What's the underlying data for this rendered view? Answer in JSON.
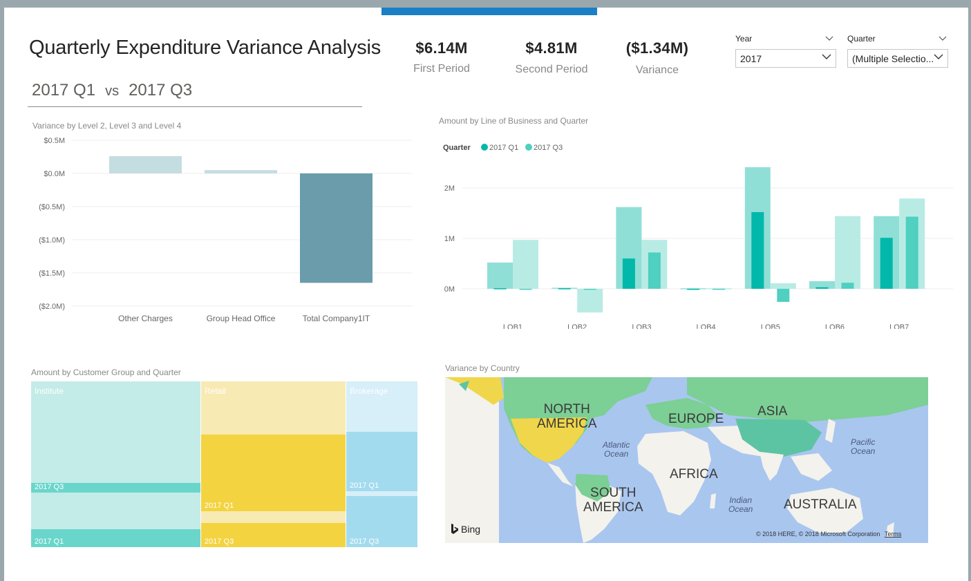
{
  "header": {
    "title": "Quarterly Expenditure Variance Analysis",
    "period_a": "2017 Q1",
    "vs": "vs",
    "period_b": "2017 Q3"
  },
  "kpis": [
    {
      "value": "$6.14M",
      "label": "First Period"
    },
    {
      "value": "$4.81M",
      "label": "Second Period"
    },
    {
      "value": "($1.34M)",
      "label": "Variance"
    }
  ],
  "slicers": {
    "year": {
      "label": "Year",
      "value": "2017"
    },
    "quarter": {
      "label": "Quarter",
      "value": "(Multiple Selectio..."
    }
  },
  "variance_chart": {
    "title": "Variance by Level 2, Level 3 and Level 4",
    "chart_data": {
      "type": "bar",
      "categories": [
        "Other Charges",
        "Group Head Office",
        "Total Company1IT"
      ],
      "values": [
        0.26,
        0.05,
        -1.65
      ],
      "ylim": [
        -2.0,
        0.5
      ],
      "yticks": [
        0.5,
        0.0,
        -0.5,
        -1.0,
        -1.5,
        -2.0
      ],
      "ytick_labels": [
        "$0.5M",
        "$0.0M",
        "($0.5M)",
        "($1.0M)",
        "($1.5M)",
        "($2.0M)"
      ],
      "colors": [
        "#c4dde1",
        "#c4dde1",
        "#6a9cab"
      ],
      "grid": true
    }
  },
  "lob_chart": {
    "title": "Amount by Line of Business and Quarter",
    "legend_title": "Quarter",
    "chart_data": {
      "type": "bar",
      "categories": [
        "LOB1",
        "LOB2",
        "LOB3",
        "LOB4",
        "LOB5",
        "LOB6",
        "LOB7"
      ],
      "series": [
        {
          "name": "2017 Q1",
          "values": [
            0.52,
            0.02,
            1.62,
            0.01,
            2.41,
            0.15,
            1.44
          ],
          "inner": [
            0.01,
            0.01,
            0.6,
            0.0,
            1.52,
            0.03,
            1.01
          ],
          "color": "#01b8aa",
          "light": "#8fdfd7"
        },
        {
          "name": "2017 Q3",
          "values": [
            0.97,
            -0.47,
            0.97,
            0.01,
            0.11,
            1.44,
            1.79
          ],
          "inner": [
            0.0,
            -0.01,
            0.72,
            0.0,
            -0.26,
            0.12,
            1.43
          ],
          "color": "#4fd0c1",
          "light": "#b9ebe5"
        }
      ],
      "ylim": [
        -0.6,
        2.5
      ],
      "yticks": [
        0,
        1,
        2
      ],
      "ytick_labels": [
        "0M",
        "1M",
        "2M"
      ],
      "legend": "top-left",
      "grid": true
    }
  },
  "treemap": {
    "title": "Amount by Customer Group and Quarter",
    "chart_data": {
      "type": "treemap",
      "groups": [
        {
          "name": "Institute",
          "color": "#6ad6cb",
          "light": "#c3ece8",
          "share": 0.44,
          "leaves": [
            {
              "label": "2017 Q3",
              "share": 0.66
            },
            {
              "label": "2017 Q1",
              "share": 0.34
            }
          ]
        },
        {
          "name": "Retail",
          "color": "#f4d340",
          "light": "#f8eab3",
          "share": 0.375,
          "leaves": [
            {
              "label": "2017 Q1",
              "share": 0.7
            },
            {
              "label": "2017 Q3",
              "share": 0.3
            }
          ]
        },
        {
          "name": "Brokerage",
          "color": "#a3dbee",
          "light": "#d6eff8",
          "share": 0.185,
          "leaves": [
            {
              "label": "2017 Q1",
              "share": 0.6
            },
            {
              "label": "2017 Q3",
              "share": 0.4
            }
          ]
        }
      ]
    }
  },
  "map": {
    "title": "Variance by Country",
    "labels": {
      "north_america": [
        "NORTH",
        "AMERICA"
      ],
      "europe": "EUROPE",
      "asia": "ASIA",
      "africa": "AFRICA",
      "south_america": [
        "SOUTH",
        "AMERICA"
      ],
      "australia": "AUSTRALIA",
      "atlantic": [
        "Atlantic",
        "Ocean"
      ],
      "pacific": [
        "Pacific",
        "Ocean"
      ],
      "indian": [
        "Indian",
        "Ocean"
      ]
    },
    "brand": "Bing",
    "copyright": "© 2018 HERE, © 2018 Microsoft Corporation",
    "terms": "Terms",
    "colors": {
      "water": "#a9c6ef",
      "land": "#f3f2ec",
      "green": "#7ccf95",
      "teal": "#5cc4a3",
      "yellow": "#f0d64a"
    }
  }
}
